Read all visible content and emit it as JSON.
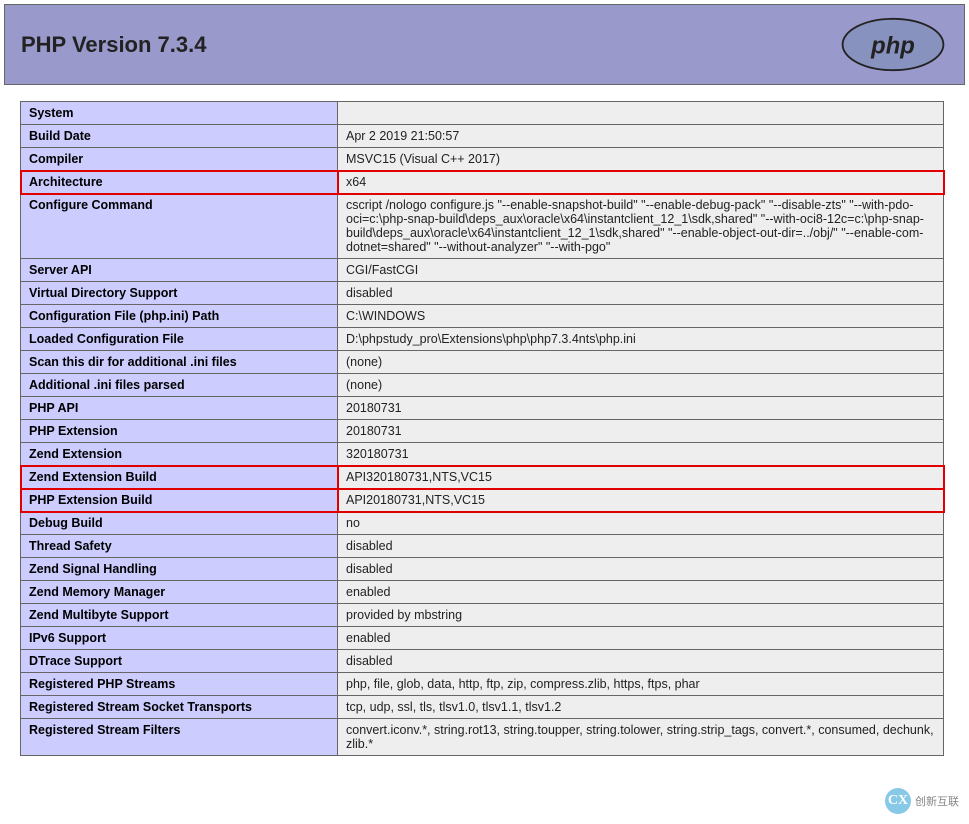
{
  "header": {
    "title": "PHP Version 7.3.4"
  },
  "rows": [
    {
      "label": "System",
      "value": "",
      "hl_label": false,
      "hl_value": false
    },
    {
      "label": "Build Date",
      "value": "Apr 2 2019 21:50:57",
      "hl_label": false,
      "hl_value": false
    },
    {
      "label": "Compiler",
      "value": "MSVC15 (Visual C++ 2017)",
      "hl_label": false,
      "hl_value": false
    },
    {
      "label": "Architecture",
      "value": "x64",
      "hl_label": true,
      "hl_value": true
    },
    {
      "label": "Configure Command",
      "value": "cscript /nologo configure.js \"--enable-snapshot-build\" \"--enable-debug-pack\" \"--disable-zts\" \"--with-pdo-oci=c:\\php-snap-build\\deps_aux\\oracle\\x64\\instantclient_12_1\\sdk,shared\" \"--with-oci8-12c=c:\\php-snap-build\\deps_aux\\oracle\\x64\\instantclient_12_1\\sdk,shared\" \"--enable-object-out-dir=../obj/\" \"--enable-com-dotnet=shared\" \"--without-analyzer\" \"--with-pgo\"",
      "hl_label": false,
      "hl_value": false
    },
    {
      "label": "Server API",
      "value": "CGI/FastCGI",
      "hl_label": false,
      "hl_value": false
    },
    {
      "label": "Virtual Directory Support",
      "value": "disabled",
      "hl_label": false,
      "hl_value": false
    },
    {
      "label": "Configuration File (php.ini) Path",
      "value": "C:\\WINDOWS",
      "hl_label": false,
      "hl_value": false
    },
    {
      "label": "Loaded Configuration File",
      "value": "D:\\phpstudy_pro\\Extensions\\php\\php7.3.4nts\\php.ini",
      "hl_label": false,
      "hl_value": false
    },
    {
      "label": "Scan this dir for additional .ini files",
      "value": "(none)",
      "hl_label": false,
      "hl_value": false
    },
    {
      "label": "Additional .ini files parsed",
      "value": "(none)",
      "hl_label": false,
      "hl_value": false
    },
    {
      "label": "PHP API",
      "value": "20180731",
      "hl_label": false,
      "hl_value": false
    },
    {
      "label": "PHP Extension",
      "value": "20180731",
      "hl_label": false,
      "hl_value": false
    },
    {
      "label": "Zend Extension",
      "value": "320180731",
      "hl_label": false,
      "hl_value": false
    },
    {
      "label": "Zend Extension Build",
      "value": "API320180731,NTS,VC15",
      "hl_label": true,
      "hl_value": true
    },
    {
      "label": "PHP Extension Build",
      "value": "API20180731,NTS,VC15",
      "hl_label": true,
      "hl_value": true
    },
    {
      "label": "Debug Build",
      "value": "no",
      "hl_label": false,
      "hl_value": false
    },
    {
      "label": "Thread Safety",
      "value": "disabled",
      "hl_label": false,
      "hl_value": false
    },
    {
      "label": "Zend Signal Handling",
      "value": "disabled",
      "hl_label": false,
      "hl_value": false
    },
    {
      "label": "Zend Memory Manager",
      "value": "enabled",
      "hl_label": false,
      "hl_value": false
    },
    {
      "label": "Zend Multibyte Support",
      "value": "provided by mbstring",
      "hl_label": false,
      "hl_value": false
    },
    {
      "label": "IPv6 Support",
      "value": "enabled",
      "hl_label": false,
      "hl_value": false
    },
    {
      "label": "DTrace Support",
      "value": "disabled",
      "hl_label": false,
      "hl_value": false
    },
    {
      "label": "Registered PHP Streams",
      "value": "php, file, glob, data, http, ftp, zip, compress.zlib, https, ftps, phar",
      "hl_label": false,
      "hl_value": false
    },
    {
      "label": "Registered Stream Socket Transports",
      "value": "tcp, udp, ssl, tls, tlsv1.0, tlsv1.1, tlsv1.2",
      "hl_label": false,
      "hl_value": false
    },
    {
      "label": "Registered Stream Filters",
      "value": "convert.iconv.*, string.rot13, string.toupper, string.tolower, string.strip_tags, convert.*, consumed, dechunk, zlib.*",
      "hl_label": false,
      "hl_value": false
    }
  ],
  "watermark": {
    "text": "创新互联"
  }
}
